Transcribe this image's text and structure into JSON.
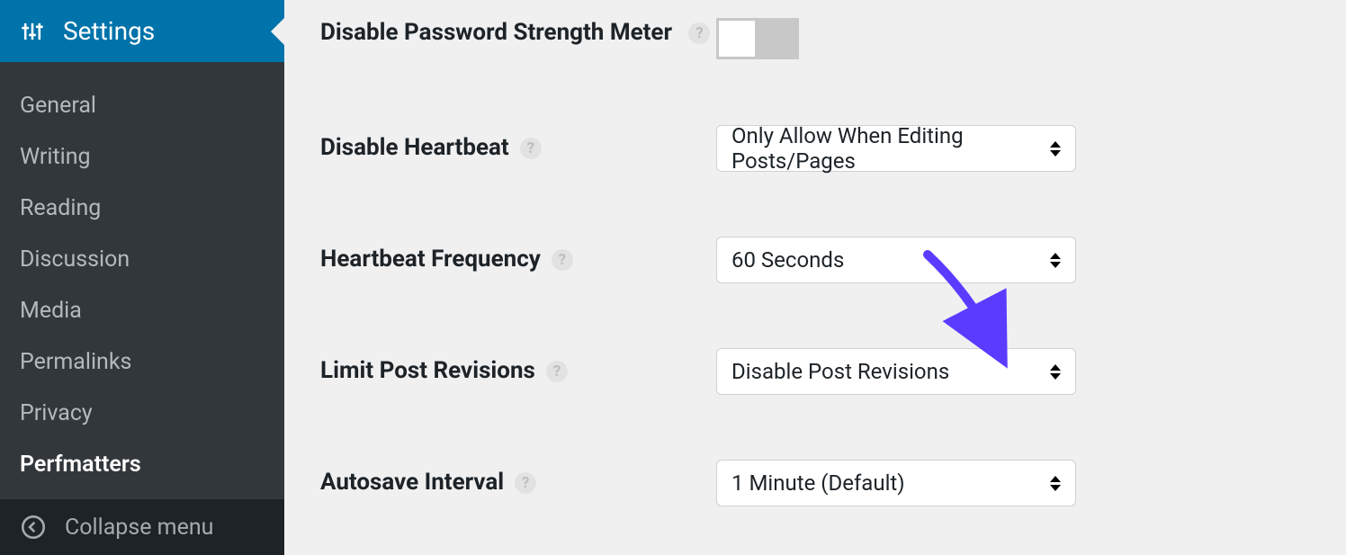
{
  "sidebar": {
    "top_label": "Settings",
    "items": [
      {
        "label": "General"
      },
      {
        "label": "Writing"
      },
      {
        "label": "Reading"
      },
      {
        "label": "Discussion"
      },
      {
        "label": "Media"
      },
      {
        "label": "Permalinks"
      },
      {
        "label": "Privacy"
      },
      {
        "label": "Perfmatters",
        "current": true
      }
    ],
    "collapse_label": "Collapse menu"
  },
  "settings": {
    "disable_password_meter": {
      "label": "Disable Password Strength Meter",
      "value": false
    },
    "disable_heartbeat": {
      "label": "Disable Heartbeat",
      "value": "Only Allow When Editing Posts/Pages"
    },
    "heartbeat_frequency": {
      "label": "Heartbeat Frequency",
      "value": "60 Seconds"
    },
    "limit_post_revisions": {
      "label": "Limit Post Revisions",
      "value": "Disable Post Revisions"
    },
    "autosave_interval": {
      "label": "Autosave Interval",
      "value": "1 Minute (Default)"
    }
  },
  "annotation": {
    "arrow_color": "#5b3bff"
  }
}
